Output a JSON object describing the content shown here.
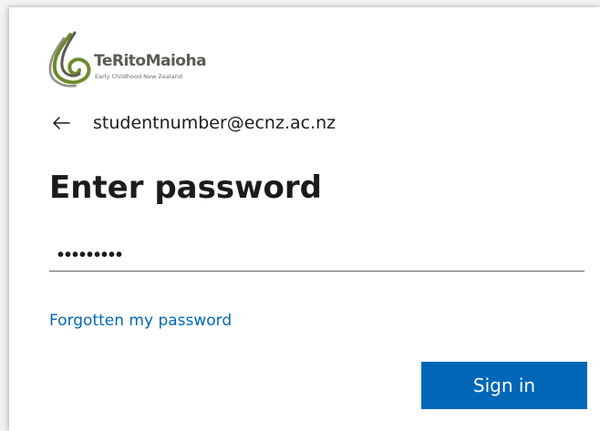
{
  "brand": {
    "name": "TeRitoMaioha",
    "tagline": "Early Childhood New Zealand",
    "logo_icon": "flax-koru-logo-icon",
    "colors": {
      "green": "#6c8a2d",
      "grey": "#5b5b52"
    }
  },
  "identity": {
    "back_icon": "back-arrow-icon",
    "email": "studentnumber@ecnz.ac.nz"
  },
  "page": {
    "title": "Enter password"
  },
  "password": {
    "value": "•••••••••",
    "type": "password"
  },
  "links": {
    "forgot_password": "Forgotten my password"
  },
  "actions": {
    "sign_in_label": "Sign in",
    "accent_color": "#0067b8"
  }
}
